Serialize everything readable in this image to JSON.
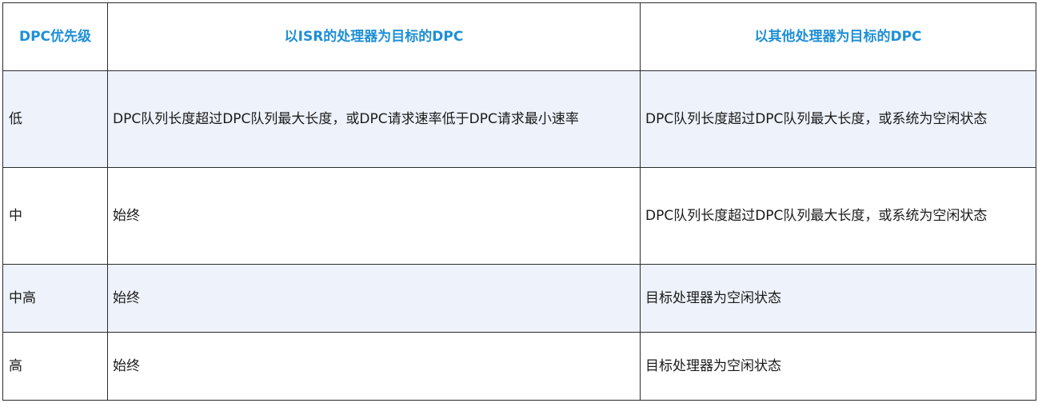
{
  "table": {
    "headers": [
      "DPC优先级",
      "以ISR的处理器为目标的DPC",
      "以其他处理器为目标的DPC"
    ],
    "rows": [
      {
        "priority": "低",
        "isr_target": "DPC队列长度超过DPC队列最大长度，或DPC请求速率低于DPC请求最小速率",
        "other_target": "DPC队列长度超过DPC队列最大长度，或系统为空闲状态"
      },
      {
        "priority": "中",
        "isr_target": "始终",
        "other_target": "DPC队列长度超过DPC队列最大长度，或系统为空闲状态"
      },
      {
        "priority": "中高",
        "isr_target": "始终",
        "other_target": "目标处理器为空闲状态"
      },
      {
        "priority": "高",
        "isr_target": "始终",
        "other_target": "目标处理器为空闲状态"
      }
    ]
  }
}
